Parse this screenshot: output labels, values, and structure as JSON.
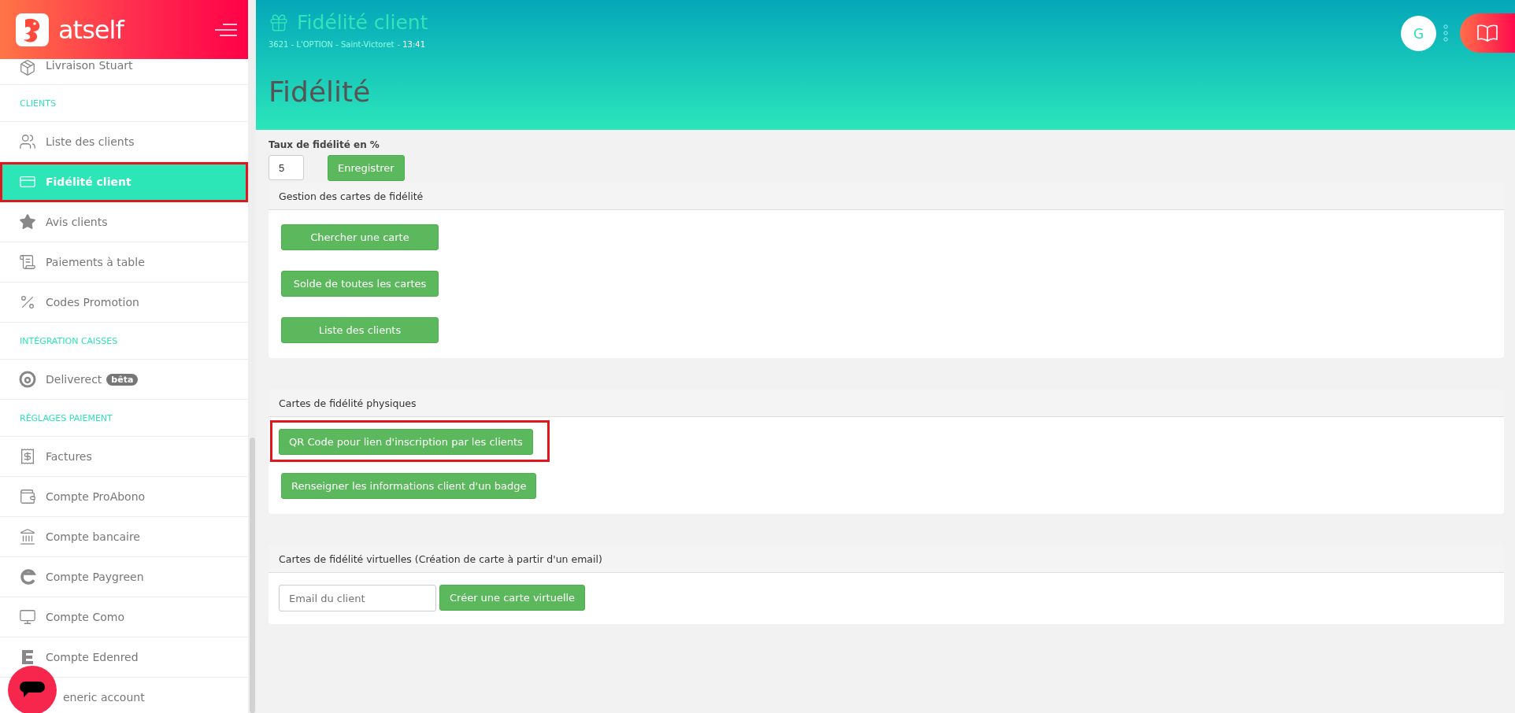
{
  "logo": {
    "text": "atself"
  },
  "sidebar": {
    "items": [
      {
        "kind": "item",
        "label": "Livraison Stuart",
        "selected": false,
        "highlighted": false
      },
      {
        "kind": "section",
        "label": "CLIENTS"
      },
      {
        "kind": "item",
        "label": "Liste des clients",
        "selected": false,
        "highlighted": false
      },
      {
        "kind": "item",
        "label": "Fidélité client",
        "selected": true,
        "highlighted": true
      },
      {
        "kind": "item",
        "label": "Avis clients",
        "selected": false,
        "highlighted": false
      },
      {
        "kind": "item",
        "label": "Paiements à table",
        "selected": false,
        "highlighted": false
      },
      {
        "kind": "item",
        "label": "Codes Promotion",
        "selected": false,
        "highlighted": false
      },
      {
        "kind": "section",
        "label": "INTÉGRATION CAISSES"
      },
      {
        "kind": "item",
        "label": "Deliverect",
        "badge": "bêta",
        "selected": false,
        "highlighted": false
      },
      {
        "kind": "section",
        "label": "RÉGLAGES PAIEMENT"
      },
      {
        "kind": "item",
        "label": "Factures",
        "selected": false,
        "highlighted": false
      },
      {
        "kind": "item",
        "label": "Compte ProAbono",
        "selected": false,
        "highlighted": false
      },
      {
        "kind": "item",
        "label": "Compte bancaire",
        "selected": false,
        "highlighted": false
      },
      {
        "kind": "item",
        "label": "Compte Paygreen",
        "selected": false,
        "highlighted": false
      },
      {
        "kind": "item",
        "label": "Compte Como",
        "selected": false,
        "highlighted": false
      },
      {
        "kind": "item",
        "label": "Compte Edenred",
        "selected": false,
        "highlighted": false
      },
      {
        "kind": "item",
        "label": "eneric account",
        "selected": false,
        "highlighted": false
      }
    ]
  },
  "header": {
    "title": "Fidélité client",
    "location": "3621 - L'OPTION - Saint-Victoret",
    "time": "- 13:41",
    "avatar": "G"
  },
  "page_title": "Fidélité",
  "rate": {
    "label": "Taux de fidélité en %",
    "value": "5",
    "save": "Enregistrer"
  },
  "cards": [
    {
      "kind": "buttons",
      "title": "Gestion des cartes de fidélité",
      "buttons": [
        {
          "label": "Chercher une carte",
          "highlighted": false
        },
        {
          "label": "Solde de toutes les cartes",
          "highlighted": false
        },
        {
          "label": "Liste des clients",
          "highlighted": false
        }
      ]
    },
    {
      "kind": "buttons",
      "title": "Cartes de fidélité physiques",
      "buttons": [
        {
          "label": "QR Code pour lien d'inscription par les clients",
          "highlighted": true
        },
        {
          "label": "Renseigner les informations client d'un badge",
          "highlighted": false
        }
      ]
    },
    {
      "kind": "email",
      "title": "Cartes de fidélité virtuelles (Création de carte à partir d'un email)",
      "placeholder": "Email du client",
      "button": "Créer une carte virtuelle"
    }
  ]
}
